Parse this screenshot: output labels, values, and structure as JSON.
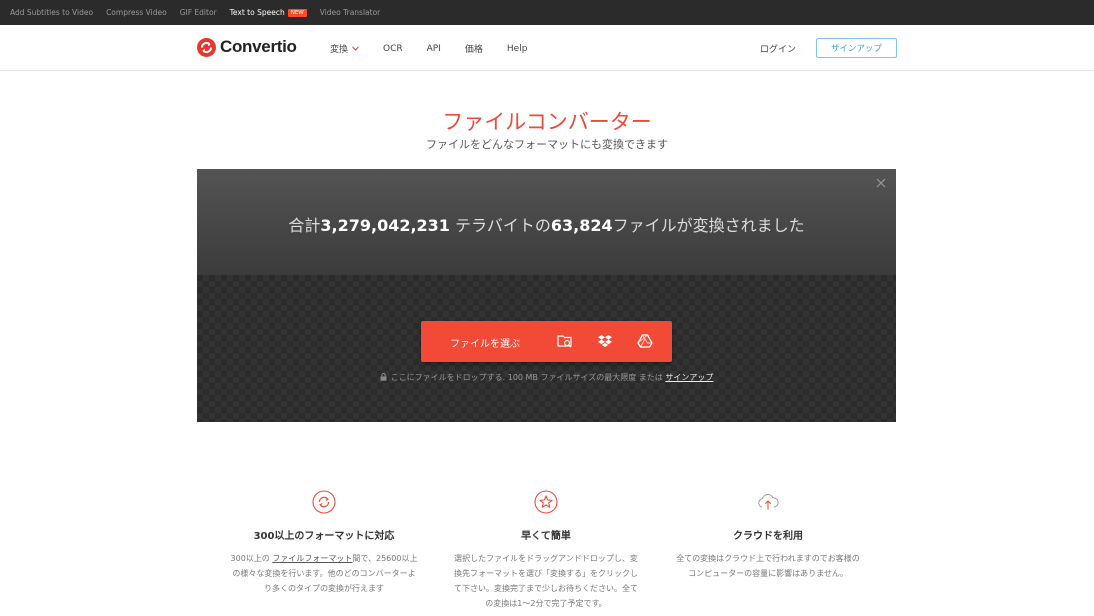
{
  "topbar": {
    "links": [
      "Add Subtitles to Video",
      "Compress Video",
      "GIF Editor",
      "Text to Speech",
      "Video Translator"
    ],
    "new_badge": "NEW",
    "active_index": 3
  },
  "header": {
    "logo_text": "Convertio",
    "nav": [
      "変換",
      "OCR",
      "API",
      "価格",
      "Help"
    ],
    "login": "ログイン",
    "signup": "サインアップ"
  },
  "hero": {
    "title": "ファイルコンバーター",
    "subtitle": "ファイルをどんなフォーマットにも変換できます"
  },
  "converter": {
    "stats_prefix": "合計",
    "stats_size": "3,279,042,231",
    "stats_mid": " テラバイトの",
    "stats_files": "63,824",
    "stats_suffix": "ファイルが変換されました",
    "choose_label": "ファイルを選ぶ",
    "drop_note": "ここにファイルをドロップする. 100 MB ファイルサイズの最大限度 または ",
    "drop_link": "サインアップ"
  },
  "features": [
    {
      "icon": "refresh-circle-icon",
      "title": "300以上のフォーマットに対応",
      "text_pre": "300以上の ",
      "text_link": "ファイルフォーマット",
      "text_post": "間で、25600以上の様々な変換を行います。他のどのコンバーターより多くのタイプの変換が行えます"
    },
    {
      "icon": "star-circle-icon",
      "title": "早くて簡単",
      "text": "選択したファイルをドラッグアンドドロップし、変換先フォーマットを選び「変換する」をクリックして下さい。変換完了まで少しお待ちください。全ての変換は1〜2分で完了予定です。"
    },
    {
      "icon": "cloud-upload-icon",
      "title": "クラウドを利用",
      "text": "全ての変換はクラウド上で行われますのでお客様のコンピューターの容量に影響はありません。"
    }
  ],
  "colors": {
    "brand_red": "#f34a38",
    "signup_blue": "#3a9fd6",
    "topbar": "#2b2b2b"
  }
}
